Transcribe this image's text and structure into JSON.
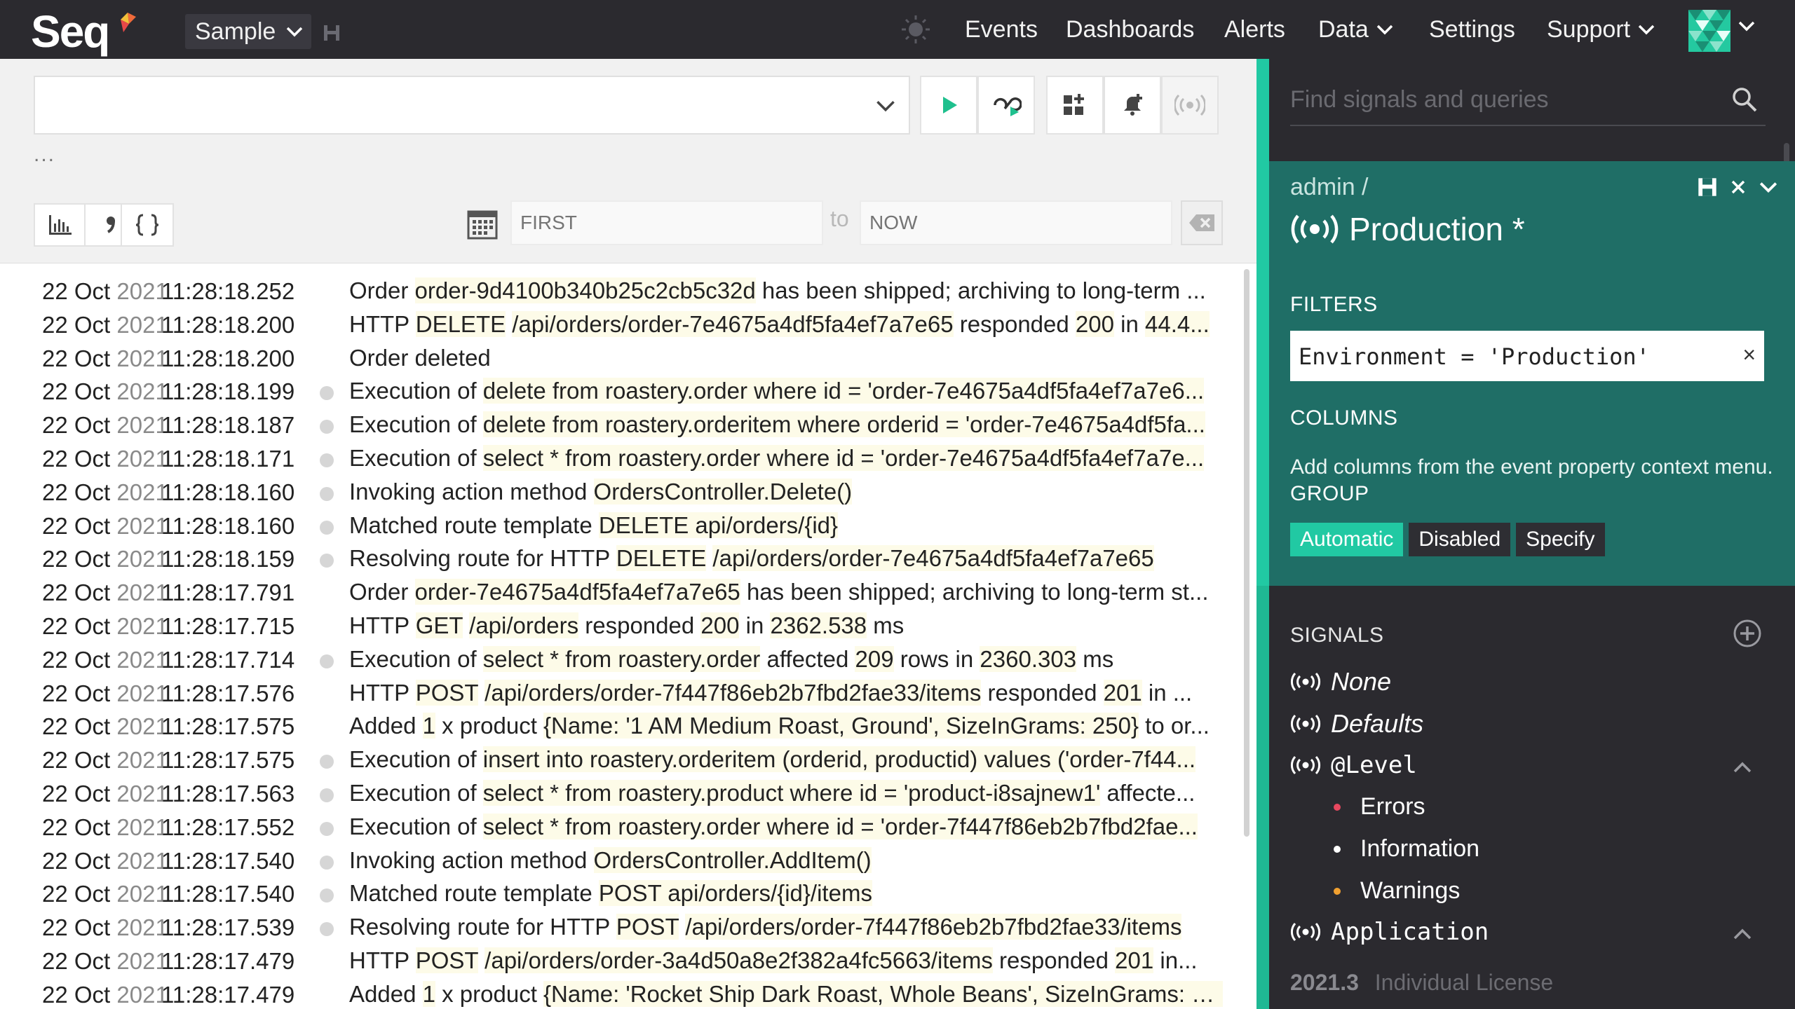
{
  "app": {
    "logo": "Seq",
    "workspace": "Sample",
    "nav": [
      "Events",
      "Dashboards",
      "Alerts",
      "Data",
      "Settings",
      "Support"
    ],
    "accent_color": "#21c9a3",
    "panel_color": "#1f6e66",
    "topbar_color": "#2b2a2f"
  },
  "query": {
    "text": "",
    "ellipsis": "...",
    "date_from_placeholder": "FIRST",
    "date_to_label": "to",
    "date_to_placeholder": "NOW"
  },
  "events": [
    {
      "date": "22 Oct",
      "year": "2021",
      "time": "11:28:18.252",
      "dot": false,
      "parts": [
        [
          "Order ",
          false
        ],
        [
          "order-9d4100b340b25c2cb5c32d",
          true
        ],
        [
          " has been shipped; archiving to long-term ...",
          false
        ]
      ]
    },
    {
      "date": "22 Oct",
      "year": "2021",
      "time": "11:28:18.200",
      "dot": false,
      "parts": [
        [
          "HTTP ",
          false
        ],
        [
          "DELETE",
          true
        ],
        [
          " ",
          false
        ],
        [
          "/api/orders/order-7e4675a4df5fa4ef7a7e65",
          true
        ],
        [
          " responded ",
          false
        ],
        [
          "200",
          true
        ],
        [
          " in ",
          false
        ],
        [
          "44.4...",
          true
        ]
      ]
    },
    {
      "date": "22 Oct",
      "year": "2021",
      "time": "11:28:18.200",
      "dot": false,
      "parts": [
        [
          "Order deleted",
          false
        ]
      ]
    },
    {
      "date": "22 Oct",
      "year": "2021",
      "time": "11:28:18.199",
      "dot": true,
      "parts": [
        [
          "Execution of ",
          false
        ],
        [
          "delete from roastery.order where id = 'order-7e4675a4df5fa4ef7a7e6...",
          true
        ]
      ]
    },
    {
      "date": "22 Oct",
      "year": "2021",
      "time": "11:28:18.187",
      "dot": true,
      "parts": [
        [
          "Execution of ",
          false
        ],
        [
          "delete from roastery.orderitem where orderid = 'order-7e4675a4df5fa...",
          true
        ]
      ]
    },
    {
      "date": "22 Oct",
      "year": "2021",
      "time": "11:28:18.171",
      "dot": true,
      "parts": [
        [
          "Execution of ",
          false
        ],
        [
          "select * from roastery.order where id = 'order-7e4675a4df5fa4ef7a7e...",
          true
        ]
      ]
    },
    {
      "date": "22 Oct",
      "year": "2021",
      "time": "11:28:18.160",
      "dot": true,
      "parts": [
        [
          "Invoking action method ",
          false
        ],
        [
          "OrdersController.Delete()",
          true
        ]
      ]
    },
    {
      "date": "22 Oct",
      "year": "2021",
      "time": "11:28:18.160",
      "dot": true,
      "parts": [
        [
          "Matched route template ",
          false
        ],
        [
          "DELETE api/orders/{id}",
          true
        ]
      ]
    },
    {
      "date": "22 Oct",
      "year": "2021",
      "time": "11:28:18.159",
      "dot": true,
      "parts": [
        [
          "Resolving route for HTTP ",
          false
        ],
        [
          "DELETE",
          true
        ],
        [
          " ",
          false
        ],
        [
          "/api/orders/order-7e4675a4df5fa4ef7a7e65",
          true
        ]
      ]
    },
    {
      "date": "22 Oct",
      "year": "2021",
      "time": "11:28:17.791",
      "dot": false,
      "parts": [
        [
          "Order ",
          false
        ],
        [
          "order-7e4675a4df5fa4ef7a7e65",
          true
        ],
        [
          " has been shipped; archiving to long-term st...",
          false
        ]
      ]
    },
    {
      "date": "22 Oct",
      "year": "2021",
      "time": "11:28:17.715",
      "dot": false,
      "parts": [
        [
          "HTTP ",
          false
        ],
        [
          "GET",
          true
        ],
        [
          " ",
          false
        ],
        [
          "/api/orders",
          true
        ],
        [
          " responded ",
          false
        ],
        [
          "200",
          true
        ],
        [
          " in ",
          false
        ],
        [
          "2362.538",
          true
        ],
        [
          " ms",
          false
        ]
      ]
    },
    {
      "date": "22 Oct",
      "year": "2021",
      "time": "11:28:17.714",
      "dot": true,
      "parts": [
        [
          "Execution of ",
          false
        ],
        [
          "select * from roastery.order",
          true
        ],
        [
          " affected ",
          false
        ],
        [
          "209",
          true
        ],
        [
          " rows in ",
          false
        ],
        [
          "2360.303",
          true
        ],
        [
          " ms",
          false
        ]
      ]
    },
    {
      "date": "22 Oct",
      "year": "2021",
      "time": "11:28:17.576",
      "dot": false,
      "parts": [
        [
          "HTTP ",
          false
        ],
        [
          "POST",
          true
        ],
        [
          " ",
          false
        ],
        [
          "/api/orders/order-7f447f86eb2b7fbd2fae33/items",
          true
        ],
        [
          " responded ",
          false
        ],
        [
          "201",
          true
        ],
        [
          " in ...",
          false
        ]
      ]
    },
    {
      "date": "22 Oct",
      "year": "2021",
      "time": "11:28:17.575",
      "dot": false,
      "parts": [
        [
          "Added ",
          false
        ],
        [
          "1",
          true
        ],
        [
          " x product ",
          false
        ],
        [
          "{Name: '1 AM Medium Roast, Ground', SizeInGrams: 250}",
          true
        ],
        [
          " to or...",
          false
        ]
      ]
    },
    {
      "date": "22 Oct",
      "year": "2021",
      "time": "11:28:17.575",
      "dot": true,
      "parts": [
        [
          "Execution of ",
          false
        ],
        [
          "insert into roastery.orderitem (orderid, productid) values ('order-7f44...",
          true
        ]
      ]
    },
    {
      "date": "22 Oct",
      "year": "2021",
      "time": "11:28:17.563",
      "dot": true,
      "parts": [
        [
          "Execution of ",
          false
        ],
        [
          "select * from roastery.product where id = 'product-i8sajnew1'",
          true
        ],
        [
          " affecte...",
          false
        ]
      ]
    },
    {
      "date": "22 Oct",
      "year": "2021",
      "time": "11:28:17.552",
      "dot": true,
      "parts": [
        [
          "Execution of ",
          false
        ],
        [
          "select * from roastery.order where id = 'order-7f447f86eb2b7fbd2fae...",
          true
        ]
      ]
    },
    {
      "date": "22 Oct",
      "year": "2021",
      "time": "11:28:17.540",
      "dot": true,
      "parts": [
        [
          "Invoking action method ",
          false
        ],
        [
          "OrdersController.AddItem()",
          true
        ]
      ]
    },
    {
      "date": "22 Oct",
      "year": "2021",
      "time": "11:28:17.540",
      "dot": true,
      "parts": [
        [
          "Matched route template ",
          false
        ],
        [
          "POST api/orders/{id}/items",
          true
        ]
      ]
    },
    {
      "date": "22 Oct",
      "year": "2021",
      "time": "11:28:17.539",
      "dot": true,
      "parts": [
        [
          "Resolving route for HTTP ",
          false
        ],
        [
          "POST",
          true
        ],
        [
          " ",
          false
        ],
        [
          "/api/orders/order-7f447f86eb2b7fbd2fae33/items",
          true
        ]
      ]
    },
    {
      "date": "22 Oct",
      "year": "2021",
      "time": "11:28:17.479",
      "dot": false,
      "parts": [
        [
          "HTTP ",
          false
        ],
        [
          "POST",
          true
        ],
        [
          " ",
          false
        ],
        [
          "/api/orders/order-3a4d50a8e2f382a4fc5663/items",
          true
        ],
        [
          " responded ",
          false
        ],
        [
          "201",
          true
        ],
        [
          " in...",
          false
        ]
      ]
    },
    {
      "date": "22 Oct",
      "year": "2021",
      "time": "11:28:17.479",
      "dot": false,
      "parts": [
        [
          "Added ",
          false
        ],
        [
          "1",
          true
        ],
        [
          " x product ",
          false
        ],
        [
          "{Name: 'Rocket Ship Dark Roast, Whole Beans', SizeInGrams: 1...",
          true
        ]
      ]
    }
  ],
  "sidebar": {
    "search_placeholder": "Find signals and queries",
    "signal": {
      "owner": "admin /",
      "title": "Production *",
      "filters_heading": "FILTERS",
      "filter": "Environment = 'Production'",
      "filter_remove": "×",
      "columns_heading": "COLUMNS",
      "columns_hint": "Add columns from the event property context menu.",
      "group_heading": "GROUP",
      "group_options": [
        "Automatic",
        "Disabled",
        "Specify"
      ],
      "group_selected": "Automatic"
    },
    "signals_heading": "SIGNALS",
    "signal_list": [
      {
        "label": "None",
        "style": "italic"
      },
      {
        "label": "Defaults",
        "style": "italic"
      },
      {
        "label": "@Level",
        "style": "mono"
      }
    ],
    "level_items": [
      {
        "label": "Errors",
        "color": "#e8485f"
      },
      {
        "label": "Information",
        "color": "#ffffff"
      },
      {
        "label": "Warnings",
        "color": "#f0a030"
      }
    ],
    "application_group": "Application",
    "version": "2021.3",
    "license": "Individual License"
  }
}
